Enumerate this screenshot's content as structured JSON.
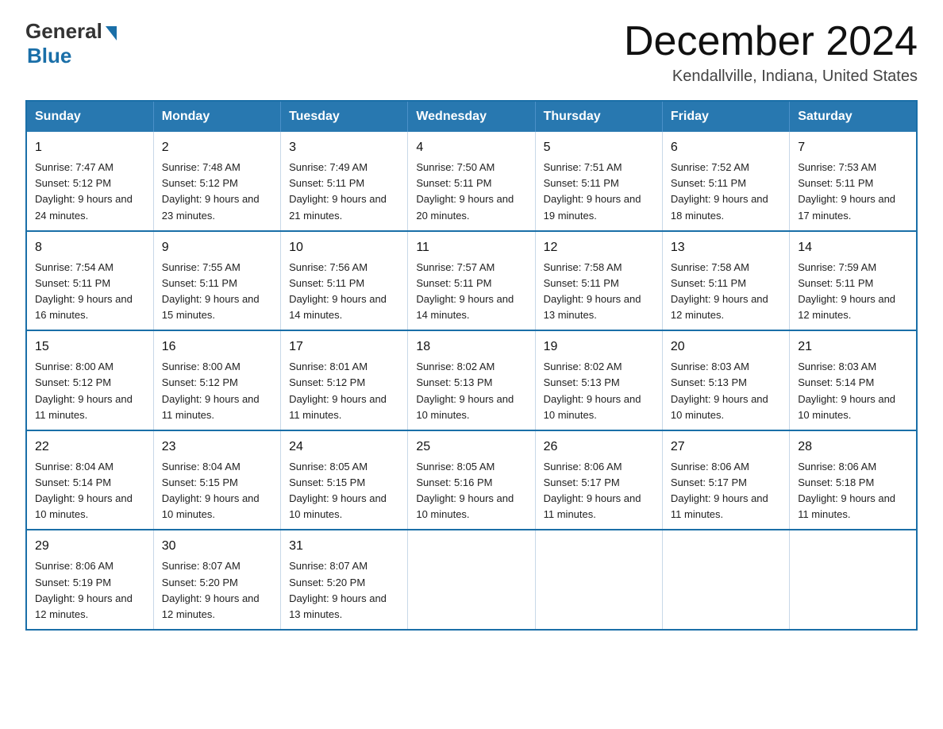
{
  "header": {
    "logo_general": "General",
    "logo_blue": "Blue",
    "month_title": "December 2024",
    "location": "Kendallville, Indiana, United States"
  },
  "days_of_week": [
    "Sunday",
    "Monday",
    "Tuesday",
    "Wednesday",
    "Thursday",
    "Friday",
    "Saturday"
  ],
  "weeks": [
    [
      {
        "day": "1",
        "sunrise": "7:47 AM",
        "sunset": "5:12 PM",
        "daylight": "9 hours and 24 minutes."
      },
      {
        "day": "2",
        "sunrise": "7:48 AM",
        "sunset": "5:12 PM",
        "daylight": "9 hours and 23 minutes."
      },
      {
        "day": "3",
        "sunrise": "7:49 AM",
        "sunset": "5:11 PM",
        "daylight": "9 hours and 21 minutes."
      },
      {
        "day": "4",
        "sunrise": "7:50 AM",
        "sunset": "5:11 PM",
        "daylight": "9 hours and 20 minutes."
      },
      {
        "day": "5",
        "sunrise": "7:51 AM",
        "sunset": "5:11 PM",
        "daylight": "9 hours and 19 minutes."
      },
      {
        "day": "6",
        "sunrise": "7:52 AM",
        "sunset": "5:11 PM",
        "daylight": "9 hours and 18 minutes."
      },
      {
        "day": "7",
        "sunrise": "7:53 AM",
        "sunset": "5:11 PM",
        "daylight": "9 hours and 17 minutes."
      }
    ],
    [
      {
        "day": "8",
        "sunrise": "7:54 AM",
        "sunset": "5:11 PM",
        "daylight": "9 hours and 16 minutes."
      },
      {
        "day": "9",
        "sunrise": "7:55 AM",
        "sunset": "5:11 PM",
        "daylight": "9 hours and 15 minutes."
      },
      {
        "day": "10",
        "sunrise": "7:56 AM",
        "sunset": "5:11 PM",
        "daylight": "9 hours and 14 minutes."
      },
      {
        "day": "11",
        "sunrise": "7:57 AM",
        "sunset": "5:11 PM",
        "daylight": "9 hours and 14 minutes."
      },
      {
        "day": "12",
        "sunrise": "7:58 AM",
        "sunset": "5:11 PM",
        "daylight": "9 hours and 13 minutes."
      },
      {
        "day": "13",
        "sunrise": "7:58 AM",
        "sunset": "5:11 PM",
        "daylight": "9 hours and 12 minutes."
      },
      {
        "day": "14",
        "sunrise": "7:59 AM",
        "sunset": "5:11 PM",
        "daylight": "9 hours and 12 minutes."
      }
    ],
    [
      {
        "day": "15",
        "sunrise": "8:00 AM",
        "sunset": "5:12 PM",
        "daylight": "9 hours and 11 minutes."
      },
      {
        "day": "16",
        "sunrise": "8:00 AM",
        "sunset": "5:12 PM",
        "daylight": "9 hours and 11 minutes."
      },
      {
        "day": "17",
        "sunrise": "8:01 AM",
        "sunset": "5:12 PM",
        "daylight": "9 hours and 11 minutes."
      },
      {
        "day": "18",
        "sunrise": "8:02 AM",
        "sunset": "5:13 PM",
        "daylight": "9 hours and 10 minutes."
      },
      {
        "day": "19",
        "sunrise": "8:02 AM",
        "sunset": "5:13 PM",
        "daylight": "9 hours and 10 minutes."
      },
      {
        "day": "20",
        "sunrise": "8:03 AM",
        "sunset": "5:13 PM",
        "daylight": "9 hours and 10 minutes."
      },
      {
        "day": "21",
        "sunrise": "8:03 AM",
        "sunset": "5:14 PM",
        "daylight": "9 hours and 10 minutes."
      }
    ],
    [
      {
        "day": "22",
        "sunrise": "8:04 AM",
        "sunset": "5:14 PM",
        "daylight": "9 hours and 10 minutes."
      },
      {
        "day": "23",
        "sunrise": "8:04 AM",
        "sunset": "5:15 PM",
        "daylight": "9 hours and 10 minutes."
      },
      {
        "day": "24",
        "sunrise": "8:05 AM",
        "sunset": "5:15 PM",
        "daylight": "9 hours and 10 minutes."
      },
      {
        "day": "25",
        "sunrise": "8:05 AM",
        "sunset": "5:16 PM",
        "daylight": "9 hours and 10 minutes."
      },
      {
        "day": "26",
        "sunrise": "8:06 AM",
        "sunset": "5:17 PM",
        "daylight": "9 hours and 11 minutes."
      },
      {
        "day": "27",
        "sunrise": "8:06 AM",
        "sunset": "5:17 PM",
        "daylight": "9 hours and 11 minutes."
      },
      {
        "day": "28",
        "sunrise": "8:06 AM",
        "sunset": "5:18 PM",
        "daylight": "9 hours and 11 minutes."
      }
    ],
    [
      {
        "day": "29",
        "sunrise": "8:06 AM",
        "sunset": "5:19 PM",
        "daylight": "9 hours and 12 minutes."
      },
      {
        "day": "30",
        "sunrise": "8:07 AM",
        "sunset": "5:20 PM",
        "daylight": "9 hours and 12 minutes."
      },
      {
        "day": "31",
        "sunrise": "8:07 AM",
        "sunset": "5:20 PM",
        "daylight": "9 hours and 13 minutes."
      },
      null,
      null,
      null,
      null
    ]
  ],
  "labels": {
    "sunrise_prefix": "Sunrise: ",
    "sunset_prefix": "Sunset: ",
    "daylight_prefix": "Daylight: "
  }
}
